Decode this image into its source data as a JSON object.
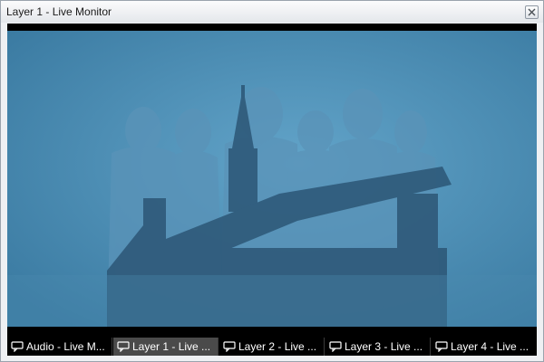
{
  "window": {
    "title": "Layer 1 - Live Monitor"
  },
  "tabs": [
    {
      "label": "Audio - Live M...",
      "active": false
    },
    {
      "label": "Layer 1 - Live ...",
      "active": true
    },
    {
      "label": "Layer 2 - Live ...",
      "active": false
    },
    {
      "label": "Layer 3 - Live ...",
      "active": false
    },
    {
      "label": "Layer 4 - Live ...",
      "active": false
    }
  ],
  "icons": {
    "close": "close-icon",
    "tab": "monitor-speech-icon"
  },
  "colors": {
    "video_tint": "#3f82aa",
    "tab_active": "#4a4a4a",
    "tab_bar": "#000000"
  }
}
